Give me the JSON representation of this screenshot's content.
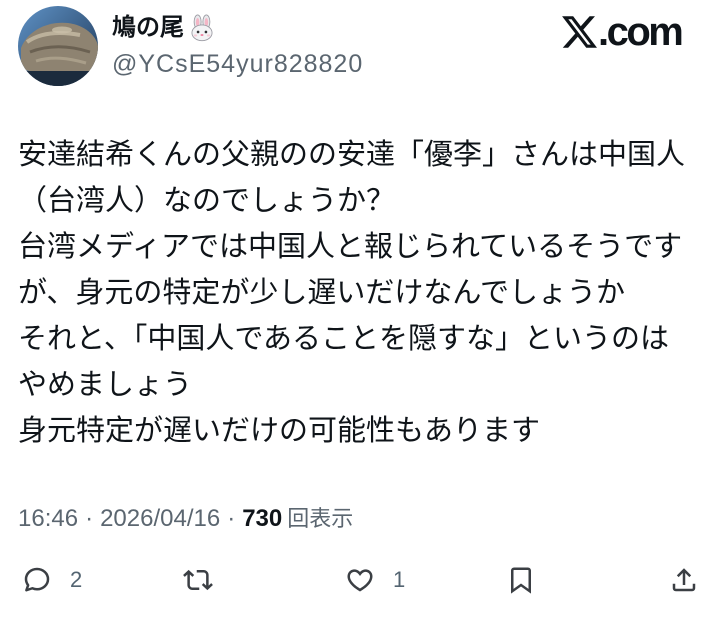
{
  "author": {
    "display_name": "鳩の尾",
    "name_emoji_icon": "rabbit-face-icon",
    "handle": "@YCsE54yur828820"
  },
  "brand": {
    "logo_icon": "x-logo-icon",
    "logo_suffix": ".com"
  },
  "tweet": {
    "text_lines": [
      "安達結希くんの父親のの安達「優李」さんは中国人",
      "（台湾人）なのでしょうか？",
      "台湾メディアでは中国人と報じられているそうです",
      "が、身元の特定が少し遅いだけなんでしょうか",
      "それと、「中国人であることを隠すな」というのは",
      "やめましょう",
      "身元特定が遅いだけの可能性もあります"
    ],
    "time": "16:46",
    "separator": "·",
    "date": "2026/04/16",
    "views_count": "730",
    "views_label": "回表示"
  },
  "actions": {
    "reply": {
      "icon": "reply-icon",
      "count": "2"
    },
    "repost": {
      "icon": "repost-icon"
    },
    "like": {
      "icon": "heart-icon",
      "count": "1"
    },
    "bookmark": {
      "icon": "bookmark-icon"
    },
    "share": {
      "icon": "share-icon"
    }
  },
  "colors": {
    "background": "#ffffff",
    "text": "#0f1419",
    "muted": "#5b6670",
    "icon": "#3b3f44"
  }
}
